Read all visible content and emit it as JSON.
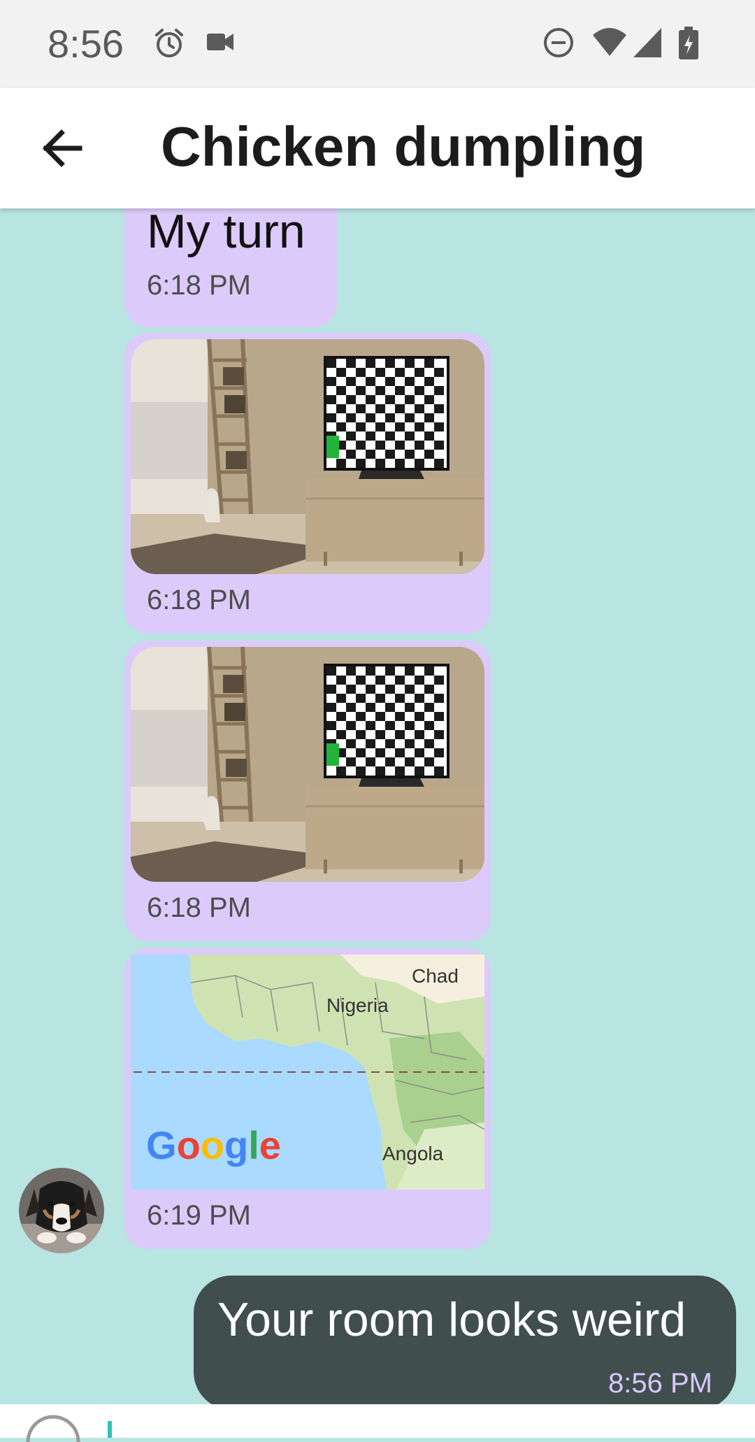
{
  "status_bar": {
    "time": "8:56",
    "icons": [
      "alarm-icon",
      "video-camera-icon",
      "do-not-disturb-icon",
      "wifi-icon",
      "cell-signal-icon",
      "battery-charging-icon"
    ]
  },
  "app_bar": {
    "title": "Chicken dumpling",
    "back_icon": "arrow-back-icon"
  },
  "messages": [
    {
      "type": "text",
      "direction": "incoming",
      "text": "My turn",
      "time": "6:18 PM"
    },
    {
      "type": "image",
      "direction": "incoming",
      "description_icon": "room-photo",
      "time": "6:18 PM"
    },
    {
      "type": "image",
      "direction": "incoming",
      "description_icon": "room-photo",
      "time": "6:18 PM"
    },
    {
      "type": "location",
      "direction": "incoming",
      "time": "6:19 PM",
      "map_labels": [
        "Chad",
        "Nigeria",
        "Angola"
      ],
      "map_brand": "Google"
    },
    {
      "type": "text",
      "direction": "outgoing",
      "text": "Your room looks weird",
      "time": "8:56 PM"
    }
  ],
  "colors": {
    "chat_background": "#b8e4e2",
    "incoming_bubble": "#dccbfa",
    "outgoing_bubble": "#414e4e",
    "outgoing_time": "#d8c8fa",
    "cursor": "#2ec4b6"
  }
}
